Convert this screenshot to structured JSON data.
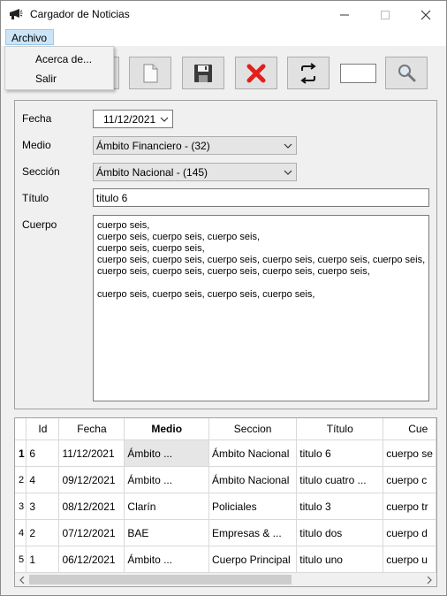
{
  "window": {
    "title": "Cargador de Noticias"
  },
  "menubar": {
    "archivo": "Archivo"
  },
  "menu_archivo": {
    "items": [
      "Acerca de...",
      "Salir"
    ]
  },
  "toolbar": {
    "buttons": [
      "open",
      "new",
      "save",
      "delete",
      "refresh",
      "search"
    ],
    "search_value": ""
  },
  "form": {
    "fecha_label": "Fecha",
    "fecha_value": "11/12/2021",
    "medio_label": "Medio",
    "medio_value": "Ámbito Financiero - (32)",
    "seccion_label": "Sección",
    "seccion_value": "Ámbito Nacional - (145)",
    "titulo_label": "Título",
    "titulo_value": "titulo 6",
    "cuerpo_label": "Cuerpo",
    "cuerpo_value": "cuerpo seis,\ncuerpo seis, cuerpo seis, cuerpo seis,\ncuerpo seis, cuerpo seis,\ncuerpo seis, cuerpo seis, cuerpo seis, cuerpo seis, cuerpo seis, cuerpo seis,\ncuerpo seis, cuerpo seis, cuerpo seis, cuerpo seis, cuerpo seis,\n\ncuerpo seis, cuerpo seis, cuerpo seis, cuerpo seis,"
  },
  "grid": {
    "columns": [
      "Id",
      "Fecha",
      "Medio",
      "Seccion",
      "Título",
      "Cue"
    ],
    "rows": [
      {
        "n": "1",
        "id": "6",
        "fecha": "11/12/2021",
        "medio": "Ámbito ...",
        "seccion": "Ámbito Nacional",
        "titulo": "titulo 6",
        "cuerpo": "cuerpo se"
      },
      {
        "n": "2",
        "id": "4",
        "fecha": "09/12/2021",
        "medio": "Ámbito ...",
        "seccion": "Ámbito Nacional",
        "titulo": "titulo cuatro ...",
        "cuerpo": "cuerpo c"
      },
      {
        "n": "3",
        "id": "3",
        "fecha": "08/12/2021",
        "medio": "Clarín",
        "seccion": "Policiales",
        "titulo": "titulo 3",
        "cuerpo": "cuerpo tr"
      },
      {
        "n": "4",
        "id": "2",
        "fecha": "07/12/2021",
        "medio": "BAE",
        "seccion": "Empresas & ...",
        "titulo": "titulo dos",
        "cuerpo": "cuerpo d"
      },
      {
        "n": "5",
        "id": "1",
        "fecha": "06/12/2021",
        "medio": "Ámbito ...",
        "seccion": "Cuerpo Principal",
        "titulo": "titulo uno",
        "cuerpo": "cuerpo u"
      }
    ]
  }
}
